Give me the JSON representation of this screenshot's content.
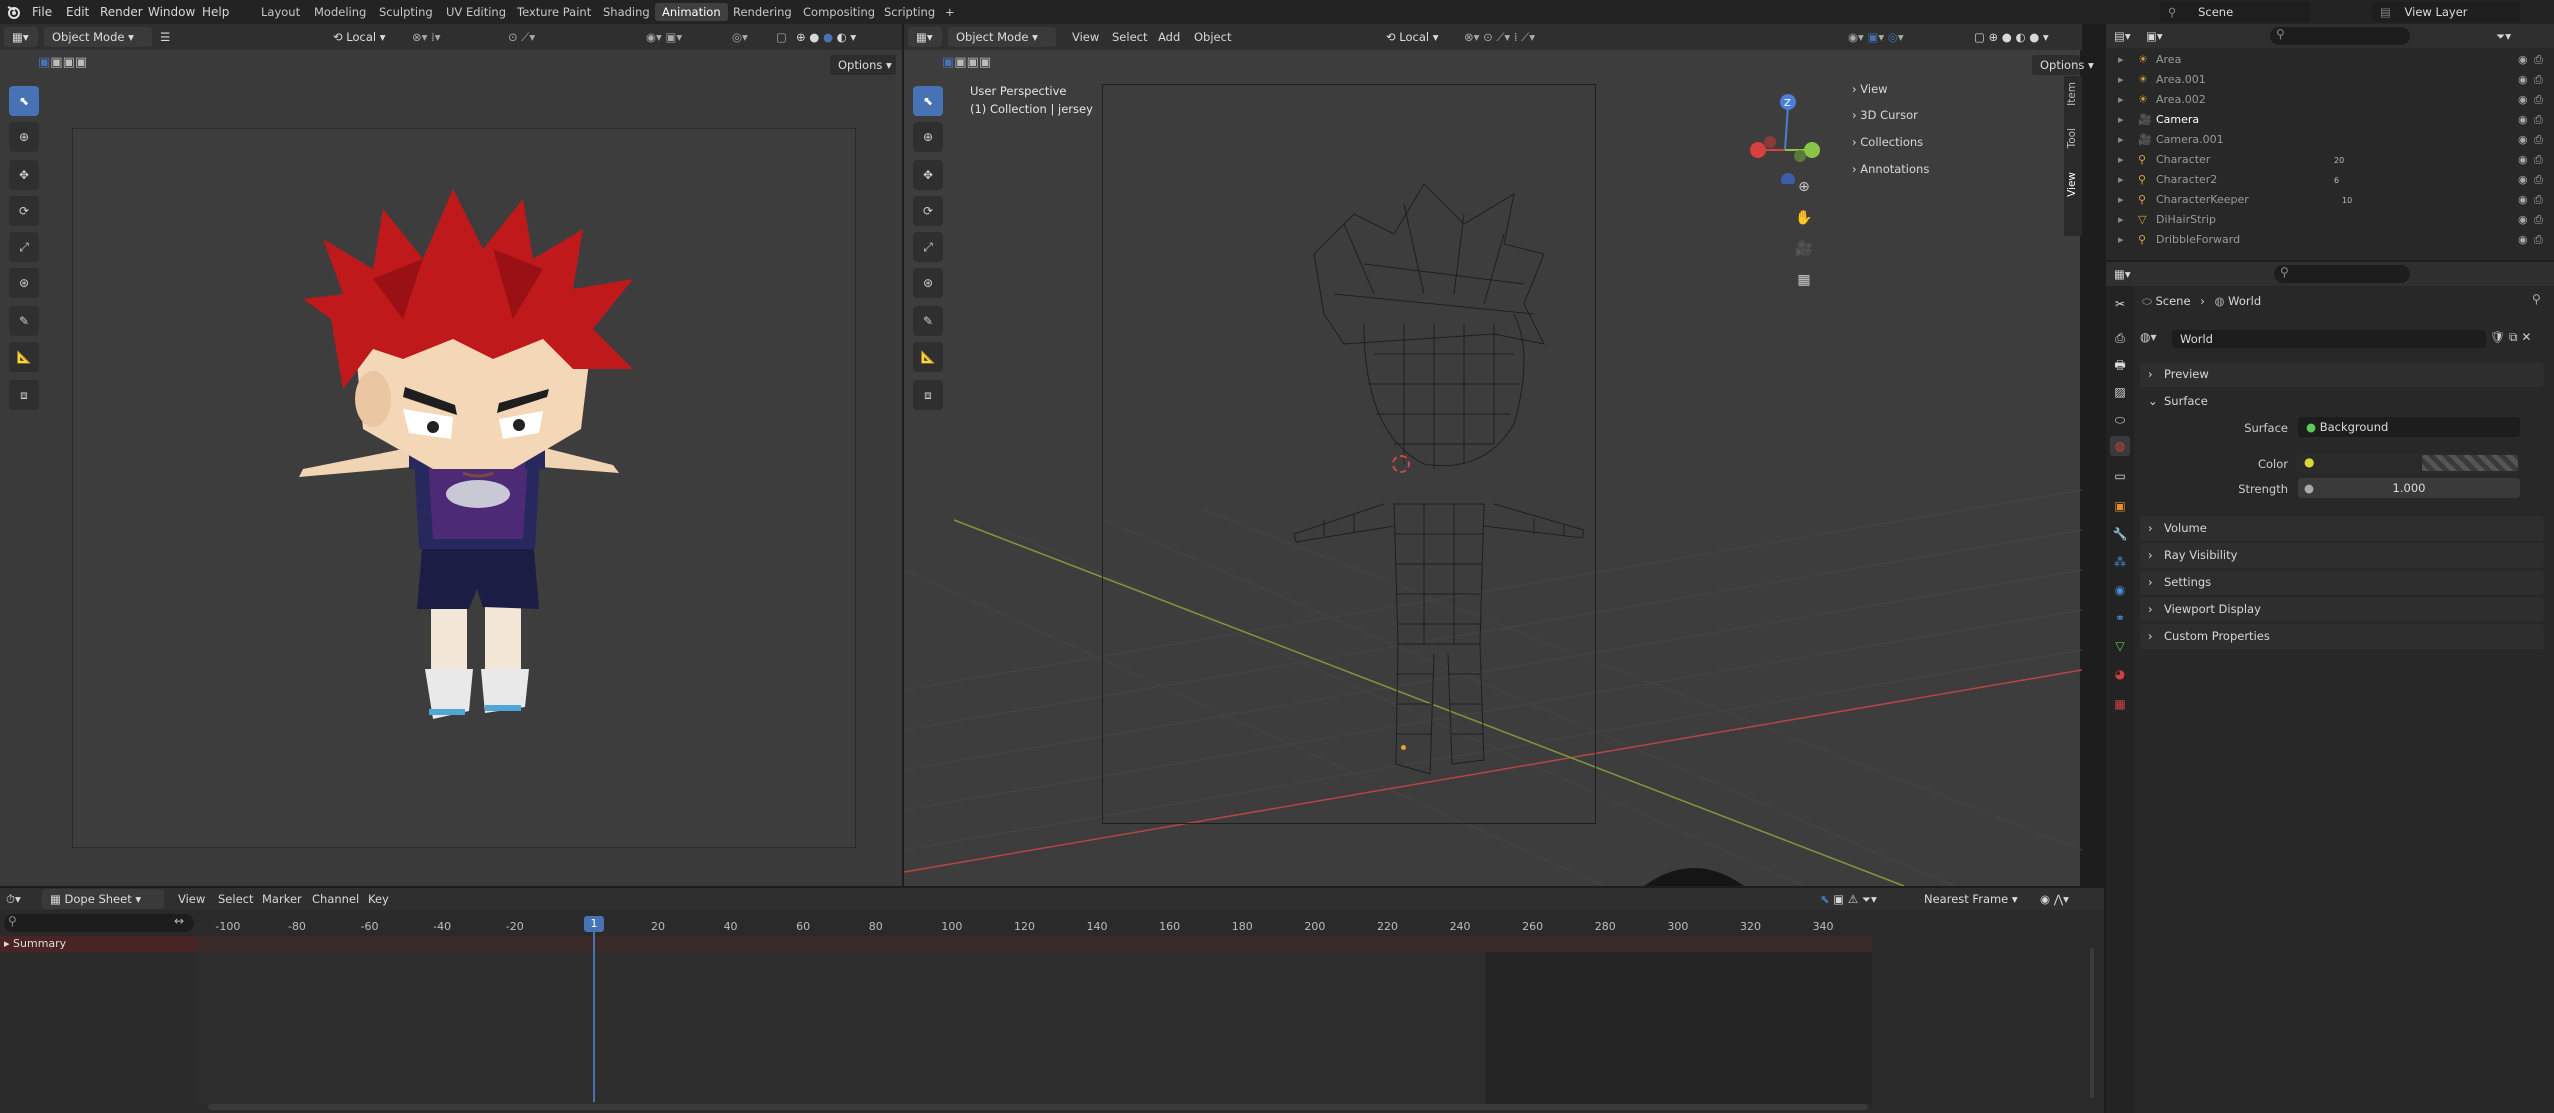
{
  "topbar": {
    "menus": [
      "File",
      "Edit",
      "Render",
      "Window",
      "Help"
    ],
    "workspaces": [
      "Layout",
      "Modeling",
      "Sculpting",
      "UV Editing",
      "Texture Paint",
      "Shading",
      "Animation",
      "Rendering",
      "Compositing",
      "Scripting"
    ],
    "active_workspace": "Animation",
    "add_tab": "+",
    "scene_name": "Scene",
    "view_layer": "View Layer"
  },
  "left_view": {
    "mode": "Object Mode",
    "orientation": "Local",
    "options": "Options"
  },
  "main_view": {
    "mode": "Object Mode",
    "menus": [
      "View",
      "Select",
      "Add",
      "Object"
    ],
    "orientation": "Local",
    "options": "Options",
    "overlay_title": "User Perspective",
    "overlay_collection": "(1) Collection | jersey",
    "npanel_items": [
      "View",
      "3D Cursor",
      "Collections",
      "Annotations"
    ],
    "npanel_tabs": [
      "Item",
      "Tool",
      "View"
    ],
    "gizmo_axis": "Z"
  },
  "outliner": {
    "rows": [
      {
        "name": "Area",
        "icon": "light-icon"
      },
      {
        "name": "Area.001",
        "icon": "light-icon"
      },
      {
        "name": "Area.002",
        "icon": "light-icon"
      },
      {
        "name": "Camera",
        "icon": "camera-icon"
      },
      {
        "name": "Camera.001",
        "icon": "camera-icon"
      },
      {
        "name": "Character",
        "icon": "armature-icon"
      },
      {
        "name": "Character2",
        "icon": "armature-icon"
      },
      {
        "name": "CharacterKeeper",
        "icon": "armature-icon"
      },
      {
        "name": "DiHairStrip",
        "icon": "mesh-icon"
      },
      {
        "name": "DribbleForward",
        "icon": "armature-icon"
      }
    ],
    "badge_counts": [
      "20",
      "6",
      "10"
    ]
  },
  "properties": {
    "breadcrumb_scene": "Scene",
    "breadcrumb_world": "World",
    "world_name": "World",
    "sections": [
      "Preview",
      "Surface",
      "Volume",
      "Ray Visibility",
      "Settings",
      "Viewport Display",
      "Custom Properties"
    ],
    "surface_label": "Surface",
    "surface_value": "Background",
    "color_label": "Color",
    "strength_label": "Strength",
    "strength_value": "1.000"
  },
  "dopesheet": {
    "editor": "Dope Sheet",
    "menus": [
      "View",
      "Select",
      "Marker",
      "Channel",
      "Key"
    ],
    "snap": "Nearest Frame",
    "summary": "Summary",
    "current_frame": "1",
    "ticks": [
      "-100",
      "-80",
      "-60",
      "-40",
      "-20",
      "20",
      "40",
      "60",
      "80",
      "100",
      "120",
      "140",
      "160",
      "180",
      "200",
      "220",
      "240",
      "260",
      "280",
      "300",
      "320",
      "340"
    ]
  },
  "colors": {
    "accent": "#4772b3",
    "axis_x": "#d84040",
    "axis_y": "#8bc34a",
    "axis_z": "#4a7fd8",
    "hair": "#c0191c"
  }
}
